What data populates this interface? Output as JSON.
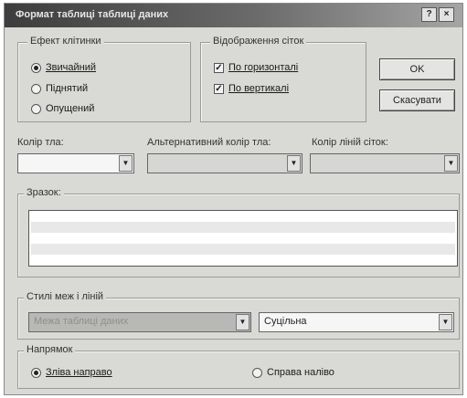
{
  "dialog": {
    "title": "Формат таблиці таблиці даних",
    "help_label": "?",
    "close_label": "×"
  },
  "cell_effect": {
    "legend": "Ефект клітинки",
    "options": [
      "Звичайний",
      "Піднятий",
      "Опущений"
    ],
    "selected": "Звичайний"
  },
  "gridlines": {
    "legend": "Відображення сіток",
    "options": [
      {
        "label": "По горизонталі",
        "checked": true
      },
      {
        "label": "По вертикалі",
        "checked": true
      }
    ]
  },
  "buttons": {
    "ok": "OK",
    "cancel": "Скасувати"
  },
  "colors": {
    "background_label": "Колір тла:",
    "background_value": "",
    "alt_background_label": "Альтернативний колір тла:",
    "alt_background_value": "",
    "gridline_label": "Колір ліній сіток:",
    "gridline_value": ""
  },
  "sample": {
    "label": "Зразок:"
  },
  "border_styles": {
    "legend": "Стилі меж і ліній",
    "element_value": "Межа таблиці даних",
    "style_value": "Суцільна"
  },
  "direction": {
    "legend": "Напрямок",
    "options": [
      "Зліва направо",
      "Справа наліво"
    ],
    "selected": "Зліва направо"
  },
  "icons": {
    "dropdown": "chevron-down-icon",
    "checkmark": "checkmark-icon"
  }
}
